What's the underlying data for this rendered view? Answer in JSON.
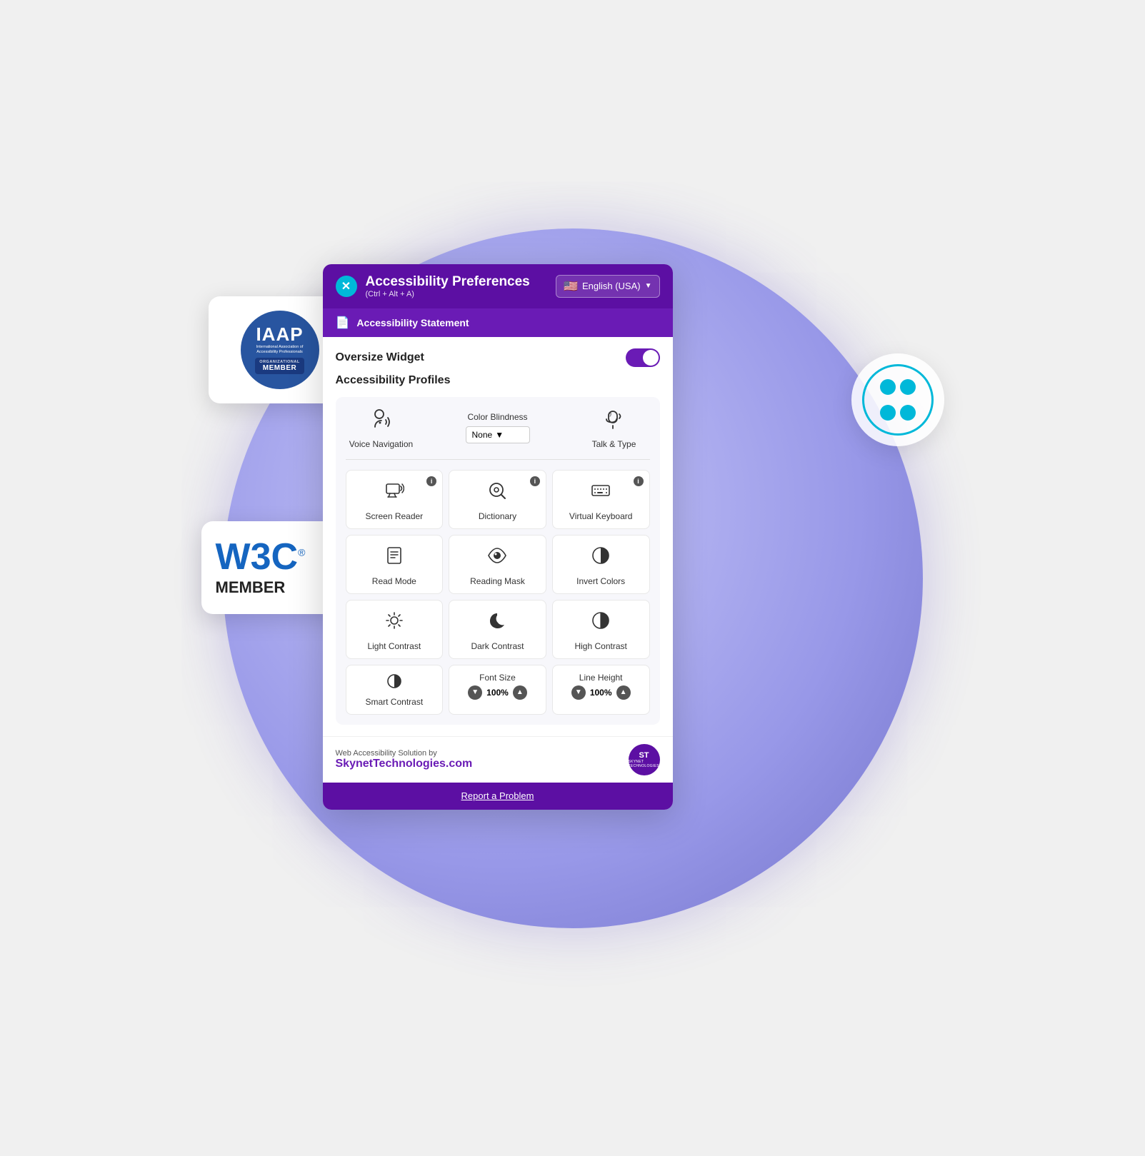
{
  "page": {
    "background": "#f0f0f0"
  },
  "iaap": {
    "main": "IAAP",
    "sub": "International Association of Accessibility Professionals",
    "org_label": "ORGANIZATIONAL",
    "org_member": "MEMBER"
  },
  "w3c": {
    "logo": "W3C",
    "reg": "®",
    "member": "MEMBER"
  },
  "panel": {
    "close_label": "✕",
    "title": "Accessibility Preferences",
    "shortcut": "(Ctrl + Alt + A)",
    "lang": "English (USA)",
    "statement": "Accessibility Statement",
    "oversize_label": "Oversize Widget",
    "profiles_label": "Accessibility Profiles",
    "voice_nav": "Voice Navigation",
    "color_blind": "Color Blindness",
    "color_blind_val": "None",
    "talk_type": "Talk & Type",
    "screen_reader": "Screen Reader",
    "dictionary": "Dictionary",
    "virtual_keyboard": "Virtual Keyboard",
    "read_mode": "Read Mode",
    "reading_mask": "Reading Mask",
    "invert_colors": "Invert Colors",
    "light_contrast": "Light Contrast",
    "dark_contrast": "Dark Contrast",
    "high_contrast": "High Contrast",
    "font_size": "Font Size",
    "font_size_val": "100%",
    "line_height": "Line Height",
    "line_height_val": "100%",
    "smart_contrast": "Smart Contrast",
    "footer_text": "Web Accessibility Solution by",
    "footer_link": "SkynetTechnologies.com",
    "footer_logo": "ST",
    "footer_logo_sub": "SKYNET TECHNOLOGIES",
    "report": "Report a Problem"
  }
}
